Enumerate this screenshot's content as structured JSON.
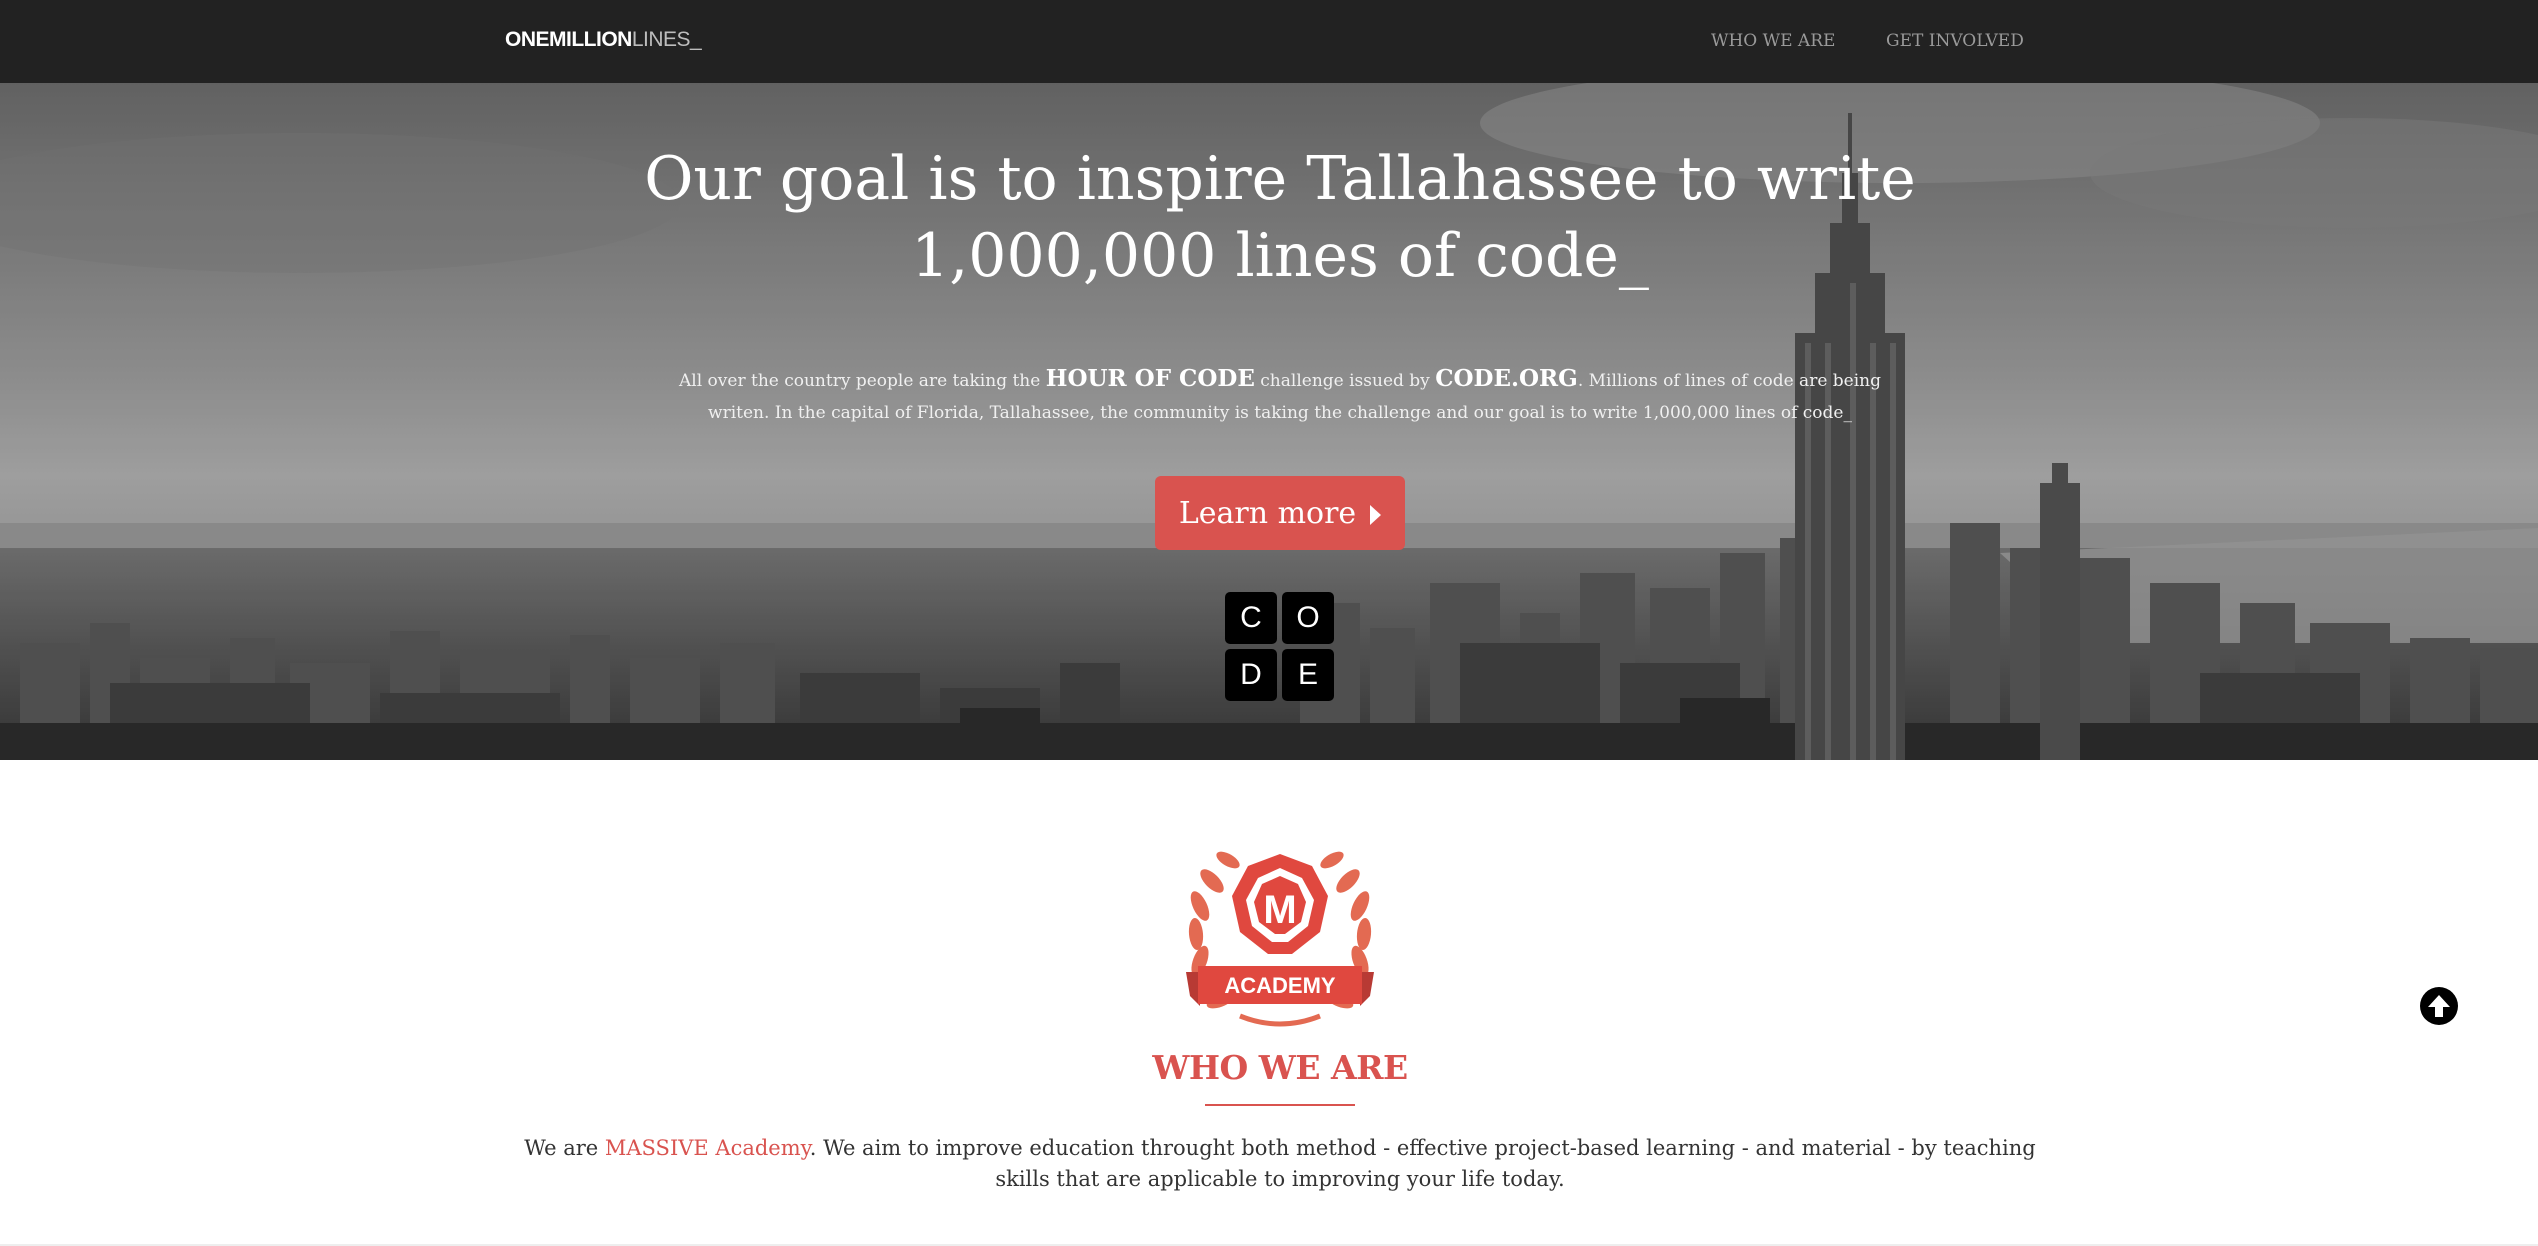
{
  "navbar": {
    "brand_strong": "ONEMILLION",
    "brand_light": "LINES_",
    "links": [
      {
        "label": "WHO WE ARE"
      },
      {
        "label": "GET INVOLVED"
      }
    ]
  },
  "hero": {
    "title": "Our goal is to inspire Tallahassee to write 1,000,000 lines of code_",
    "text_part1": "All over the country people are taking the ",
    "text_em1": "HOUR OF CODE",
    "text_part2": " challenge issued by ",
    "text_em2": "CODE.ORG",
    "text_part3": ". Millions of lines of code are being writen. In the capital of Florida, Tallahassee, the community is taking the challenge and our goal is to write 1,000,000 lines of code_",
    "button_label": "Learn more",
    "code_logo_letters": [
      "C",
      "O",
      "D",
      "E"
    ]
  },
  "who_we_are": {
    "logo_letter": "M",
    "logo_banner": "ACADEMY",
    "title": "WHO WE ARE",
    "text_part1": "We are ",
    "text_highlight": "MASSIVE Academy",
    "text_part2": ". We aim to improve education throught both method - effective project-based learning - and material - by teaching skills that are applicable to improving your life today."
  },
  "colors": {
    "accent": "#d9534f",
    "navbar_bg": "#222222",
    "hero_overlay": "#8f8f8f"
  },
  "icons": {
    "scroll_top": "arrow-circle-up-icon",
    "button_caret": "caret-right-icon"
  }
}
